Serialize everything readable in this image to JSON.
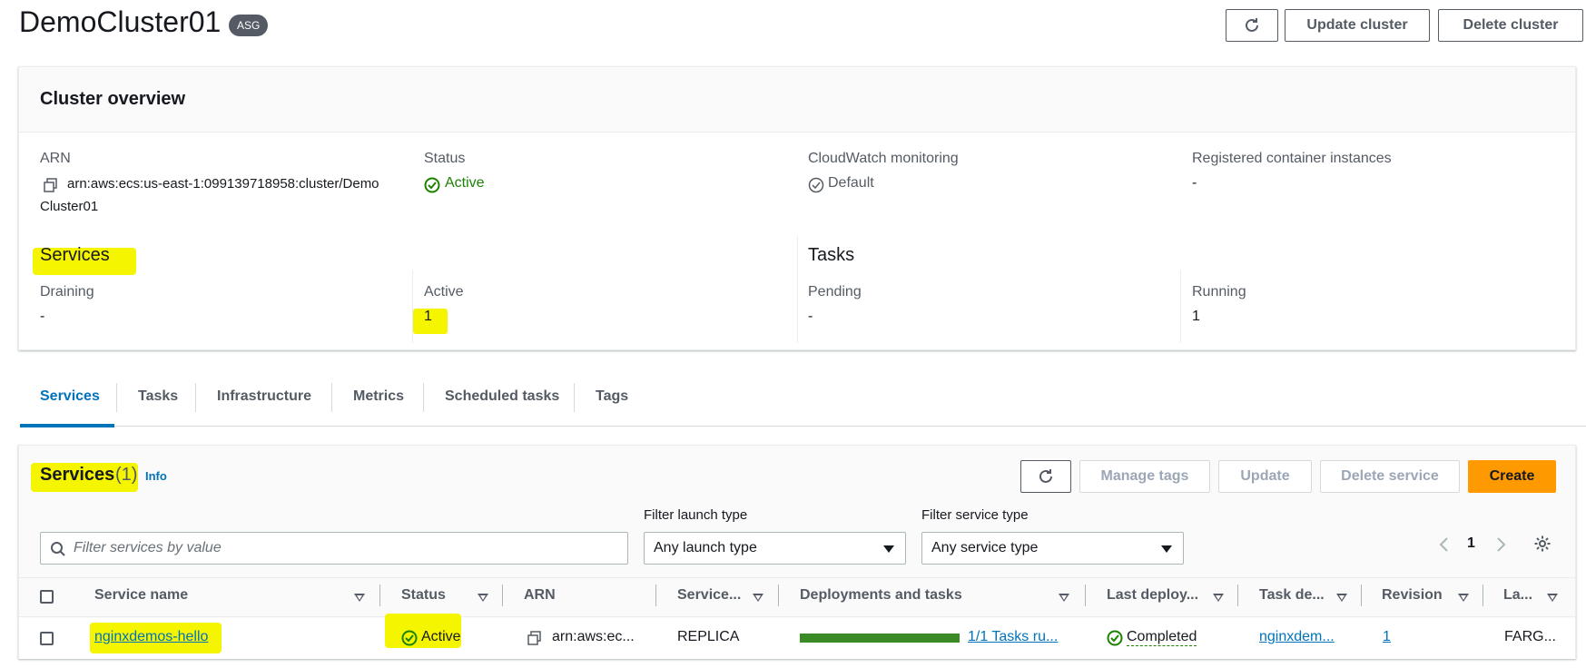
{
  "header": {
    "title": "DemoCluster01",
    "badge": "ASG",
    "update_label": "Update cluster",
    "delete_label": "Delete cluster"
  },
  "overview": {
    "heading": "Cluster overview",
    "arn_label": "ARN",
    "arn_line1": "arn:aws:ecs:us-east-1:099139718958:cluster/Demo",
    "arn_line2": "Cluster01",
    "status_label": "Status",
    "status_value": "Active",
    "cloudwatch_label": "CloudWatch monitoring",
    "cloudwatch_value": "Default",
    "registered_label": "Registered container instances",
    "registered_value": "-",
    "services_heading": "Services",
    "tasks_heading": "Tasks",
    "draining_label": "Draining",
    "draining_value": "-",
    "active_label": "Active",
    "active_value": "1",
    "pending_label": "Pending",
    "pending_value": "-",
    "running_label": "Running",
    "running_value": "1"
  },
  "tabs": [
    {
      "label": "Services"
    },
    {
      "label": "Tasks"
    },
    {
      "label": "Infrastructure"
    },
    {
      "label": "Metrics"
    },
    {
      "label": "Scheduled tasks"
    },
    {
      "label": "Tags"
    }
  ],
  "services_panel": {
    "title": "Services",
    "count": "(1)",
    "info": "Info",
    "manage_tags": "Manage tags",
    "update": "Update",
    "delete_service": "Delete service",
    "create": "Create",
    "search_placeholder": "Filter services by value",
    "filter_launch_label": "Filter launch type",
    "filter_launch_value": "Any launch type",
    "filter_service_label": "Filter service type",
    "filter_service_value": "Any service type",
    "page": "1"
  },
  "table": {
    "columns": [
      "Service name",
      "Status",
      "ARN",
      "Service...",
      "Deployments and tasks",
      "Last deploy...",
      "Task de...",
      "Revision",
      "La..."
    ],
    "rows": [
      {
        "service_name": "nginxdemos-hello",
        "status": "Active",
        "arn": "arn:aws:ec...",
        "service_type": "REPLICA",
        "deployment_progress": 1.0,
        "tasks": "1/1 Tasks ru...",
        "last_deployment": "Completed",
        "task_definition": "nginxdem...",
        "revision": "1",
        "launch_type": "FARG..."
      }
    ]
  },
  "colors": {
    "primary": "#ff9900",
    "link": "#0073bb",
    "success": "#1d8102",
    "highlight": "#f5f500",
    "progress": "#3b8a28"
  }
}
